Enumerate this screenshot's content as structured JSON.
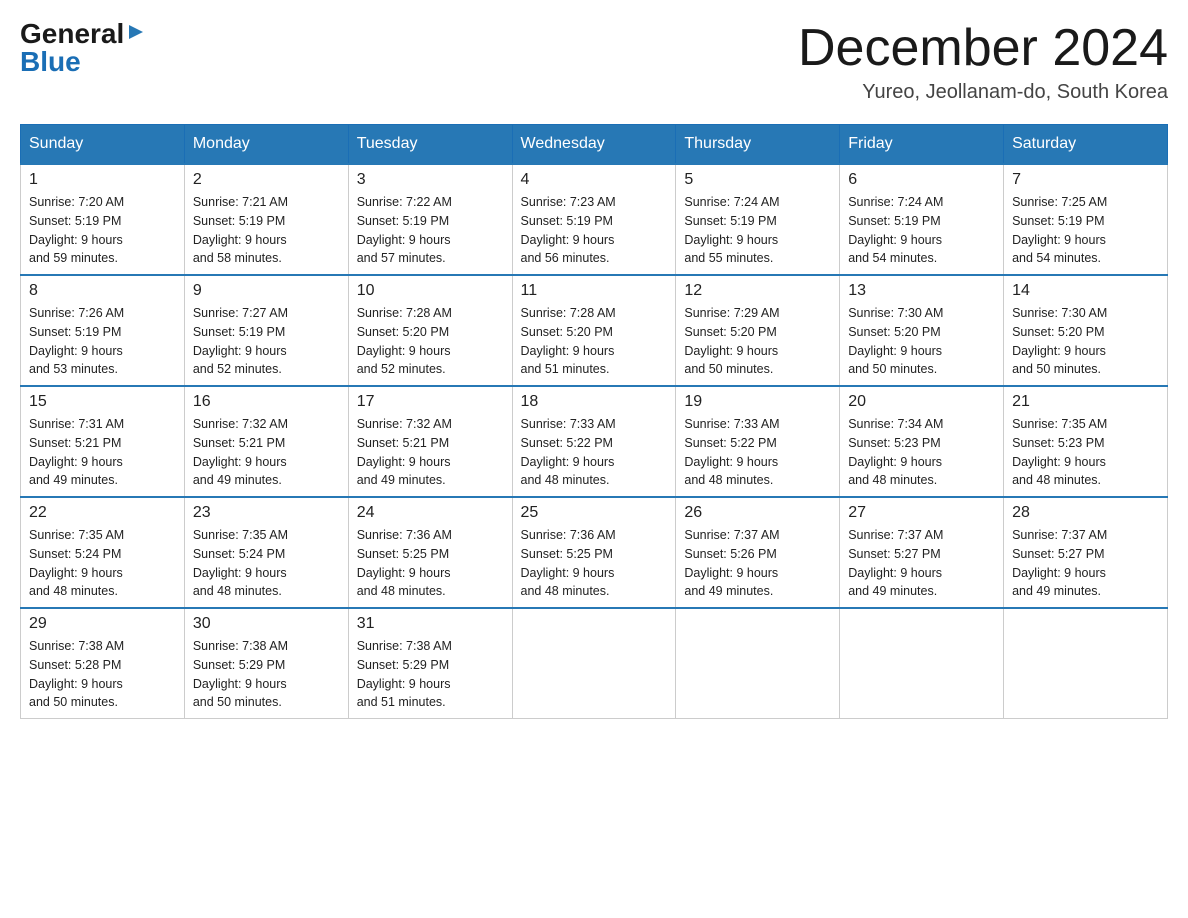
{
  "logo": {
    "general": "General",
    "blue": "Blue",
    "triangle": "▶"
  },
  "header": {
    "month_title": "December 2024",
    "location": "Yureo, Jeollanam-do, South Korea"
  },
  "weekdays": [
    "Sunday",
    "Monday",
    "Tuesday",
    "Wednesday",
    "Thursday",
    "Friday",
    "Saturday"
  ],
  "weeks": [
    [
      {
        "day": "1",
        "sunrise": "7:20 AM",
        "sunset": "5:19 PM",
        "daylight": "9 hours and 59 minutes."
      },
      {
        "day": "2",
        "sunrise": "7:21 AM",
        "sunset": "5:19 PM",
        "daylight": "9 hours and 58 minutes."
      },
      {
        "day": "3",
        "sunrise": "7:22 AM",
        "sunset": "5:19 PM",
        "daylight": "9 hours and 57 minutes."
      },
      {
        "day": "4",
        "sunrise": "7:23 AM",
        "sunset": "5:19 PM",
        "daylight": "9 hours and 56 minutes."
      },
      {
        "day": "5",
        "sunrise": "7:24 AM",
        "sunset": "5:19 PM",
        "daylight": "9 hours and 55 minutes."
      },
      {
        "day": "6",
        "sunrise": "7:24 AM",
        "sunset": "5:19 PM",
        "daylight": "9 hours and 54 minutes."
      },
      {
        "day": "7",
        "sunrise": "7:25 AM",
        "sunset": "5:19 PM",
        "daylight": "9 hours and 54 minutes."
      }
    ],
    [
      {
        "day": "8",
        "sunrise": "7:26 AM",
        "sunset": "5:19 PM",
        "daylight": "9 hours and 53 minutes."
      },
      {
        "day": "9",
        "sunrise": "7:27 AM",
        "sunset": "5:19 PM",
        "daylight": "9 hours and 52 minutes."
      },
      {
        "day": "10",
        "sunrise": "7:28 AM",
        "sunset": "5:20 PM",
        "daylight": "9 hours and 52 minutes."
      },
      {
        "day": "11",
        "sunrise": "7:28 AM",
        "sunset": "5:20 PM",
        "daylight": "9 hours and 51 minutes."
      },
      {
        "day": "12",
        "sunrise": "7:29 AM",
        "sunset": "5:20 PM",
        "daylight": "9 hours and 50 minutes."
      },
      {
        "day": "13",
        "sunrise": "7:30 AM",
        "sunset": "5:20 PM",
        "daylight": "9 hours and 50 minutes."
      },
      {
        "day": "14",
        "sunrise": "7:30 AM",
        "sunset": "5:20 PM",
        "daylight": "9 hours and 50 minutes."
      }
    ],
    [
      {
        "day": "15",
        "sunrise": "7:31 AM",
        "sunset": "5:21 PM",
        "daylight": "9 hours and 49 minutes."
      },
      {
        "day": "16",
        "sunrise": "7:32 AM",
        "sunset": "5:21 PM",
        "daylight": "9 hours and 49 minutes."
      },
      {
        "day": "17",
        "sunrise": "7:32 AM",
        "sunset": "5:21 PM",
        "daylight": "9 hours and 49 minutes."
      },
      {
        "day": "18",
        "sunrise": "7:33 AM",
        "sunset": "5:22 PM",
        "daylight": "9 hours and 48 minutes."
      },
      {
        "day": "19",
        "sunrise": "7:33 AM",
        "sunset": "5:22 PM",
        "daylight": "9 hours and 48 minutes."
      },
      {
        "day": "20",
        "sunrise": "7:34 AM",
        "sunset": "5:23 PM",
        "daylight": "9 hours and 48 minutes."
      },
      {
        "day": "21",
        "sunrise": "7:35 AM",
        "sunset": "5:23 PM",
        "daylight": "9 hours and 48 minutes."
      }
    ],
    [
      {
        "day": "22",
        "sunrise": "7:35 AM",
        "sunset": "5:24 PM",
        "daylight": "9 hours and 48 minutes."
      },
      {
        "day": "23",
        "sunrise": "7:35 AM",
        "sunset": "5:24 PM",
        "daylight": "9 hours and 48 minutes."
      },
      {
        "day": "24",
        "sunrise": "7:36 AM",
        "sunset": "5:25 PM",
        "daylight": "9 hours and 48 minutes."
      },
      {
        "day": "25",
        "sunrise": "7:36 AM",
        "sunset": "5:25 PM",
        "daylight": "9 hours and 48 minutes."
      },
      {
        "day": "26",
        "sunrise": "7:37 AM",
        "sunset": "5:26 PM",
        "daylight": "9 hours and 49 minutes."
      },
      {
        "day": "27",
        "sunrise": "7:37 AM",
        "sunset": "5:27 PM",
        "daylight": "9 hours and 49 minutes."
      },
      {
        "day": "28",
        "sunrise": "7:37 AM",
        "sunset": "5:27 PM",
        "daylight": "9 hours and 49 minutes."
      }
    ],
    [
      {
        "day": "29",
        "sunrise": "7:38 AM",
        "sunset": "5:28 PM",
        "daylight": "9 hours and 50 minutes."
      },
      {
        "day": "30",
        "sunrise": "7:38 AM",
        "sunset": "5:29 PM",
        "daylight": "9 hours and 50 minutes."
      },
      {
        "day": "31",
        "sunrise": "7:38 AM",
        "sunset": "5:29 PM",
        "daylight": "9 hours and 51 minutes."
      },
      null,
      null,
      null,
      null
    ]
  ],
  "labels": {
    "sunrise_prefix": "Sunrise: ",
    "sunset_prefix": "Sunset: ",
    "daylight_prefix": "Daylight: "
  }
}
